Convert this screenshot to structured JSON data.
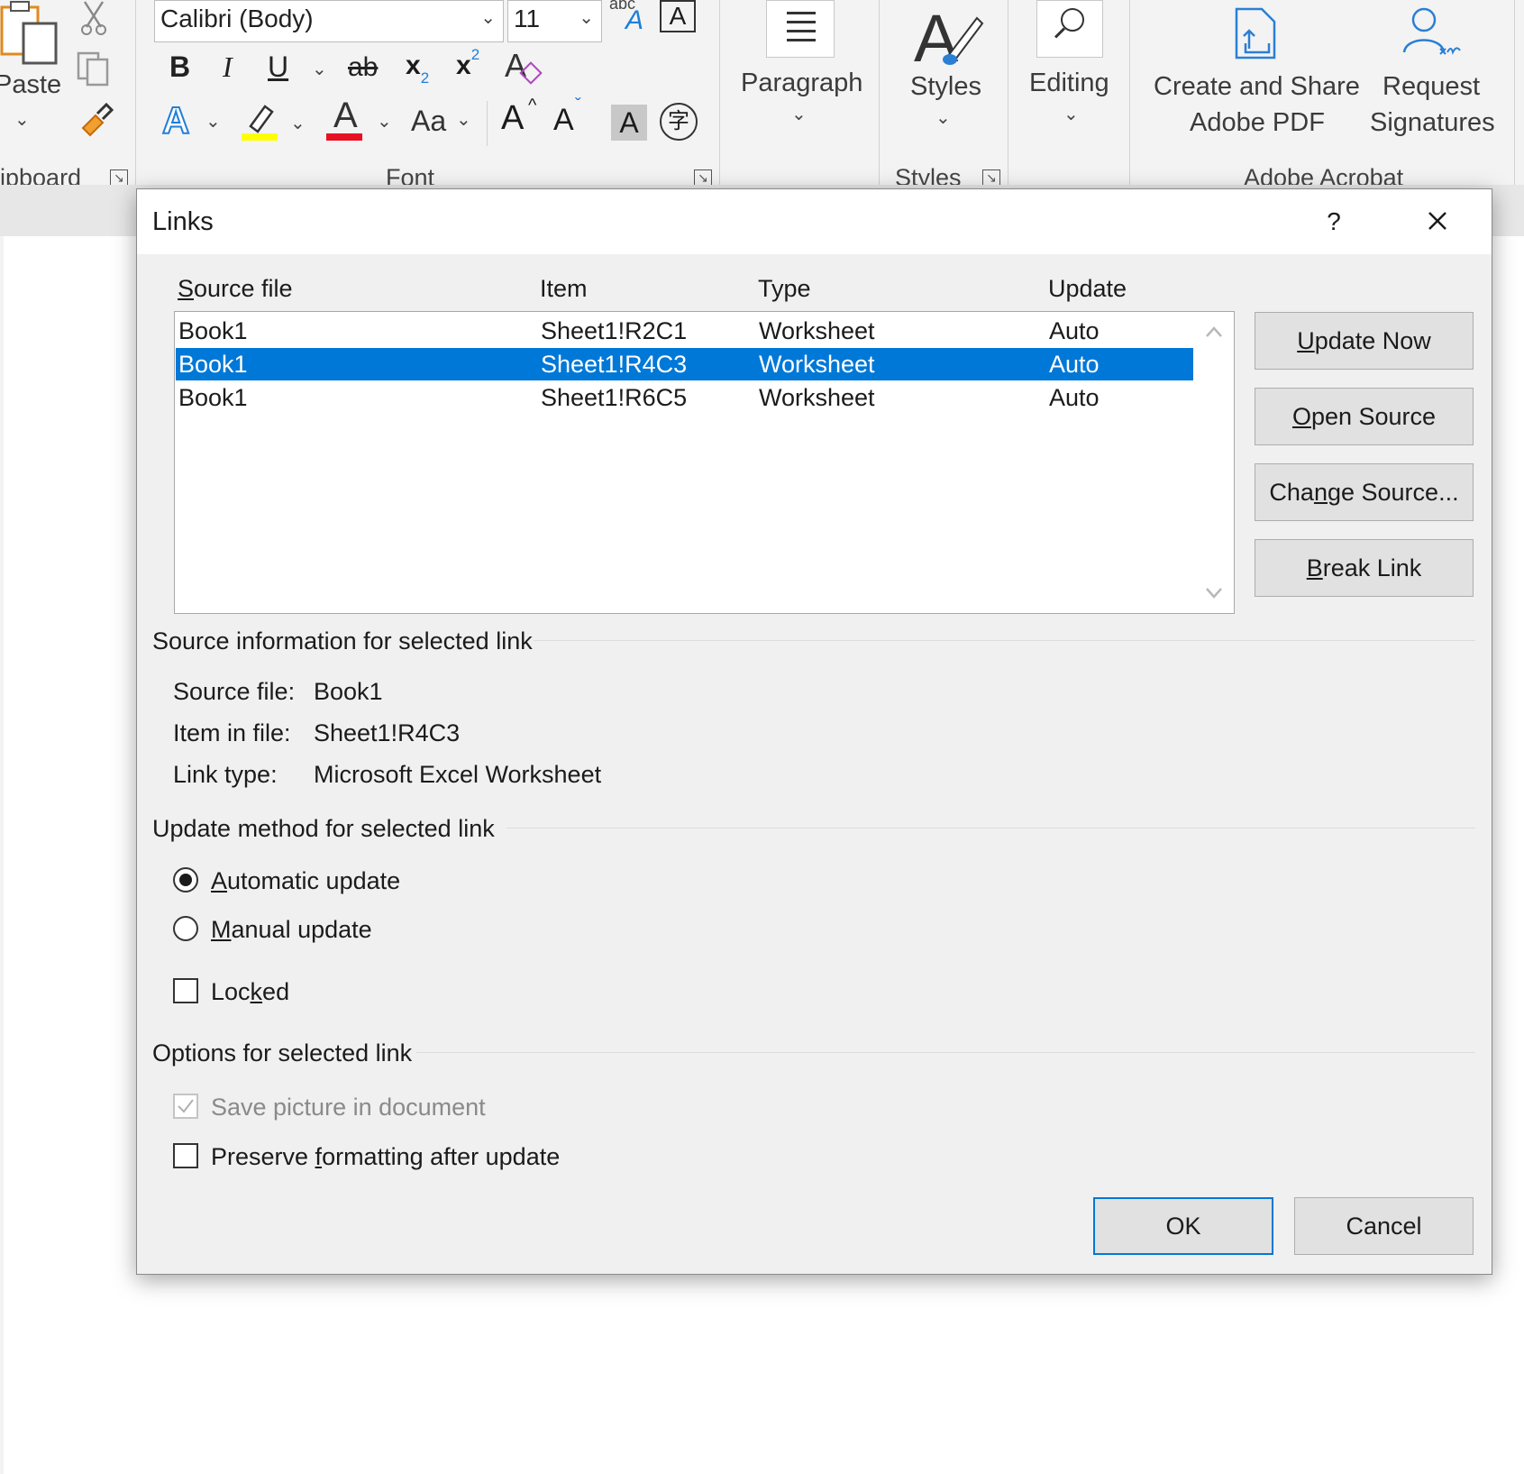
{
  "ribbon": {
    "clipboard": {
      "paste_label": "Paste",
      "group_label": "ipboard"
    },
    "font": {
      "font_name": "Calibri (Body)",
      "font_size": "11",
      "group_label": "Font",
      "bold": "B",
      "italic": "I",
      "underline": "U",
      "strikethrough": "ab",
      "subscript": "x",
      "subscript_sub": "2",
      "superscript": "x",
      "superscript_sup": "2",
      "change_case": "Aa",
      "grow_font": "A",
      "shrink_font": "A",
      "char_shading": "A",
      "abc_label": "abc",
      "font_color_accent": "#e81123",
      "highlight_accent": "#ffff00",
      "text_effects_accent": "#1e7fd8"
    },
    "paragraph": {
      "label": "Paragraph"
    },
    "styles": {
      "label": "Styles",
      "group_label": "Styles"
    },
    "editing": {
      "label": "Editing"
    },
    "acrobat": {
      "create_share_line1": "Create and Share",
      "create_share_line2": "Adobe PDF",
      "request_line1": "Request",
      "request_line2": "Signatures",
      "group_label": "Adobe Acrobat"
    }
  },
  "dialog": {
    "title": "Links",
    "help": "?",
    "columns": {
      "source_file": {
        "u": "S",
        "rest": "ource file"
      },
      "item": "Item",
      "type": "Type",
      "update": "Update"
    },
    "rows": [
      {
        "source": "Book1",
        "item": "Sheet1!R2C1",
        "type": "Worksheet",
        "update": "Auto"
      },
      {
        "source": "Book1",
        "item": "Sheet1!R4C3",
        "type": "Worksheet",
        "update": "Auto",
        "selected": true
      },
      {
        "source": "Book1",
        "item": "Sheet1!R6C5",
        "type": "Worksheet",
        "update": "Auto"
      }
    ],
    "buttons": {
      "update_now": {
        "u": "U",
        "rest": "pdate Now"
      },
      "open_source": {
        "u": "O",
        "rest": "pen Source"
      },
      "change_source": {
        "pre": "Cha",
        "u": "n",
        "rest": "ge Source..."
      },
      "break_link": {
        "u": "B",
        "rest": "reak Link"
      },
      "ok": "OK",
      "cancel": "Cancel"
    },
    "source_info": {
      "title": "Source information for selected link",
      "source_file_label": "Source file:",
      "source_file_value": "Book1",
      "item_label": "Item in file:",
      "item_value": "Sheet1!R4C3",
      "link_type_label": "Link type:",
      "link_type_value": "Microsoft Excel Worksheet"
    },
    "update_method": {
      "title": "Update method for selected link",
      "automatic": {
        "u": "A",
        "rest": "utomatic update",
        "checked": true
      },
      "manual": {
        "u": "M",
        "rest": "anual update",
        "checked": false
      },
      "locked": {
        "pre": "Loc",
        "u": "k",
        "rest": "ed",
        "checked": false
      }
    },
    "options": {
      "title": "Options for selected link",
      "save_picture": {
        "label": "Save picture in document",
        "checked": true,
        "disabled": true
      },
      "preserve": {
        "pre": "Preserve ",
        "u": "f",
        "rest": "ormatting after update",
        "checked": false
      }
    },
    "accent_color": "#0078d7"
  }
}
